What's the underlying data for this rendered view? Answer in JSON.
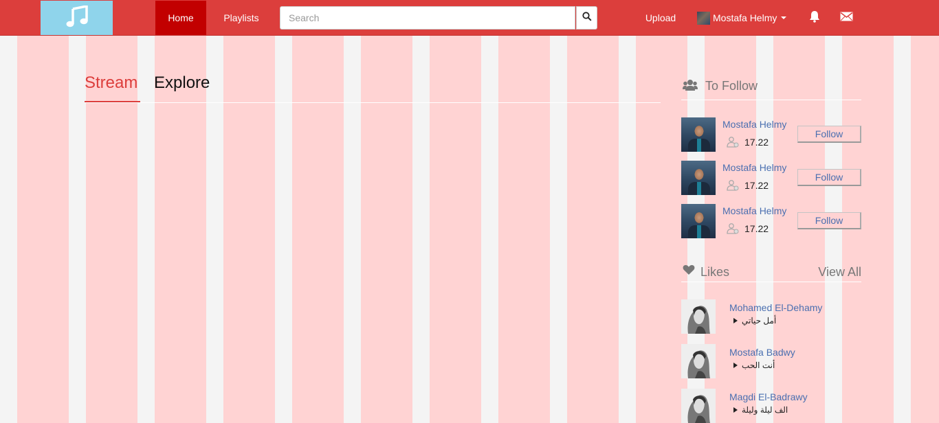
{
  "navbar": {
    "logo_icon": "music-note-icon",
    "home_label": "Home",
    "playlists_label": "Playlists",
    "search_placeholder": "Search",
    "search_icon": "search-icon",
    "upload_label": "Upload",
    "user_name": "Mostafa Helmy",
    "bell_icon": "bell-icon",
    "mail_icon": "envelope-icon"
  },
  "tabs": {
    "stream": "Stream",
    "explore": "Explore"
  },
  "to_follow": {
    "title": "To Follow",
    "icon": "users-icon",
    "button_label": "Follow",
    "items": [
      {
        "name": "Mostafa Helmy",
        "count": "17.22"
      },
      {
        "name": "Mostafa Helmy",
        "count": "17.22"
      },
      {
        "name": "Mostafa Helmy",
        "count": "17.22"
      }
    ]
  },
  "likes": {
    "title": "Likes",
    "icon": "heart-icon",
    "view_all": "View All",
    "items": [
      {
        "artist": "Mohamed El-Dehamy",
        "track": "أمل حياتي"
      },
      {
        "artist": "Mostafa Badwy",
        "track": "أنت الحب"
      },
      {
        "artist": "Magdi El-Badrawy",
        "track": "الف ليلة وليلة"
      }
    ]
  },
  "colors": {
    "navbar": "#dc3e3c",
    "home_active": "#c20000",
    "logo_bg": "#8fd4eb",
    "column_pink": "#ffd3d3",
    "gutter_gray": "#f4f4f4",
    "link_blue": "#4a6fb0"
  }
}
